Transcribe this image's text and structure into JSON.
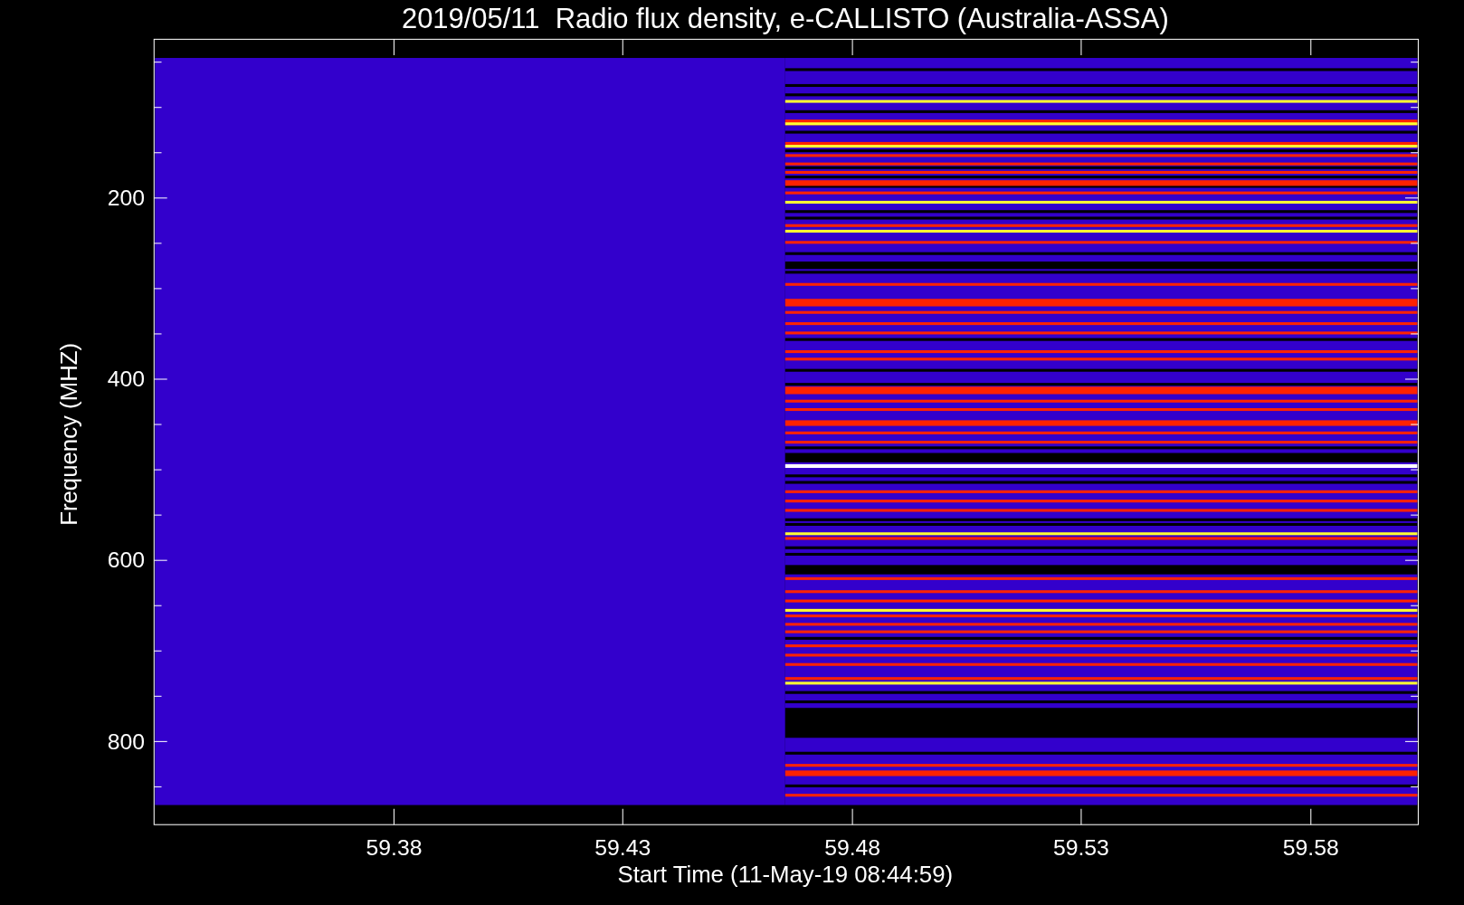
{
  "chart": {
    "title": "2019/05/11  Radio flux density, e-CALLISTO (Australia-ASSA)",
    "xlabel": "Start Time (11-May-19 08:44:59)",
    "ylabel": "Frequency (MHZ)",
    "xtick_labels": [
      "59.38",
      "59.43",
      "59.48",
      "59.53",
      "59.58"
    ],
    "ytick_labels": [
      "200",
      "400",
      "600",
      "800"
    ]
  }
}
